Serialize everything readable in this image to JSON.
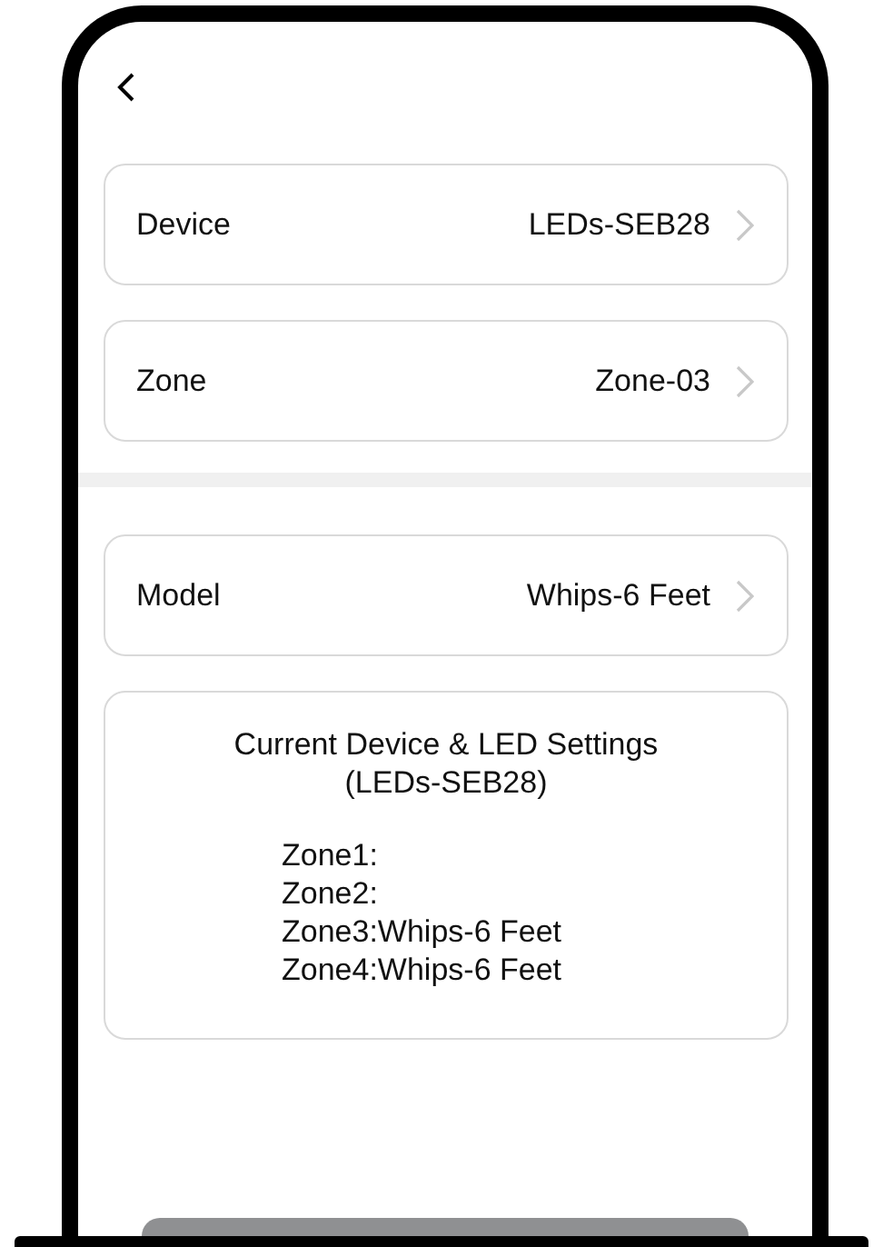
{
  "rows_top": [
    {
      "label": "Device",
      "value": "LEDs-SEB28"
    },
    {
      "label": "Zone",
      "value": "Zone-03"
    }
  ],
  "rows_bottom": [
    {
      "label": "Model",
      "value": "Whips-6 Feet"
    }
  ],
  "settings": {
    "title": "Current Device & LED Settings",
    "subtitle": "(LEDs-SEB28)",
    "lines": [
      "Zone1:",
      "Zone2:",
      "Zone3:Whips-6 Feet",
      "Zone4:Whips-6 Feet"
    ]
  },
  "bottom_button": {
    "disabled": true
  }
}
